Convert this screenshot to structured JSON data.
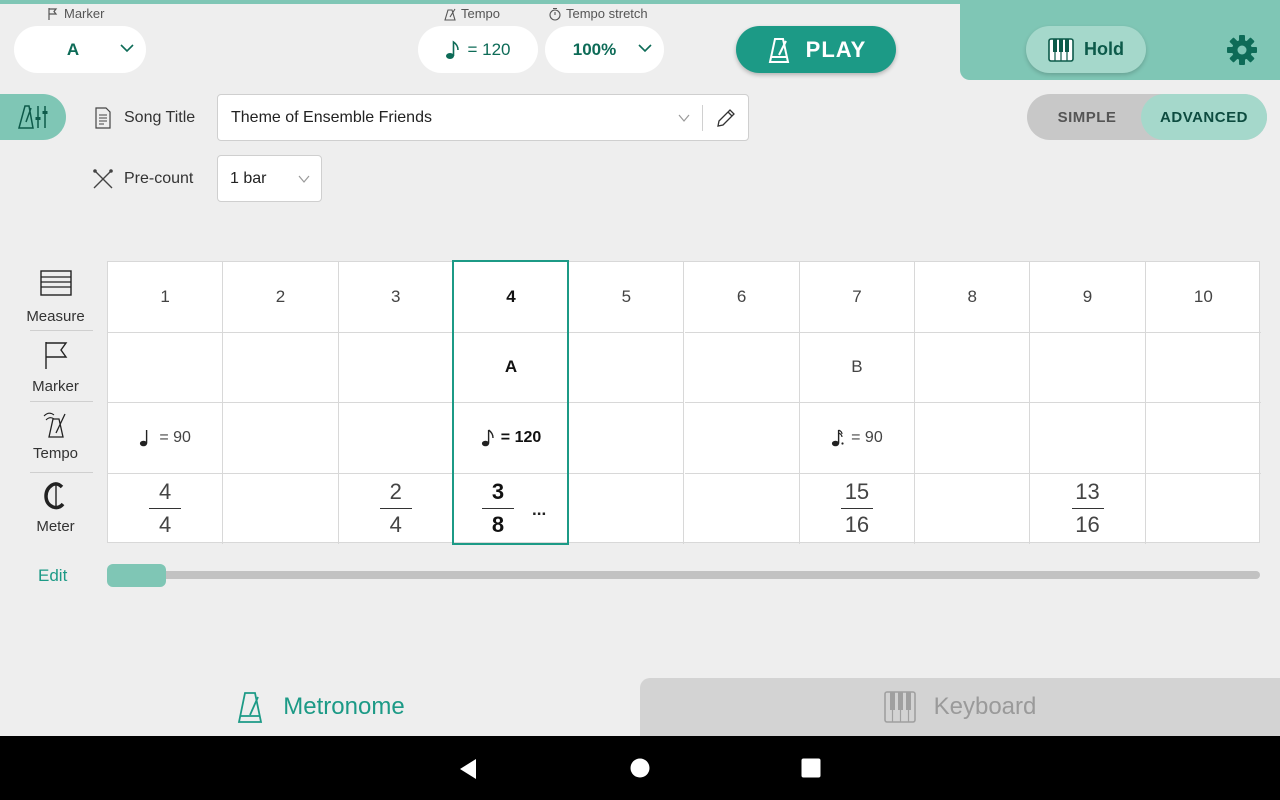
{
  "topbar": {
    "marker_label": "Marker",
    "marker_value": "A",
    "tempo_label": "Tempo",
    "tempo_value": "= 120",
    "tempo_stretch_label": "Tempo stretch",
    "tempo_stretch_value": "100%",
    "play_label": "PLAY",
    "hold_label": "Hold"
  },
  "song": {
    "title_label": "Song Title",
    "title_value": "Theme of Ensemble Friends",
    "precount_label": "Pre-count",
    "precount_value": "1 bar"
  },
  "mode_toggle": {
    "simple": "SIMPLE",
    "advanced": "ADVANCED",
    "selected": "ADVANCED"
  },
  "sidebar_rows": {
    "measure": "Measure",
    "marker": "Marker",
    "tempo": "Tempo",
    "meter": "Meter"
  },
  "grid": {
    "measures": [
      "1",
      "2",
      "3",
      "4",
      "5",
      "6",
      "7",
      "8",
      "9",
      "10"
    ],
    "selected_measure": "4",
    "markers": [
      "",
      "",
      "",
      "A",
      "",
      "",
      "B",
      "",
      "",
      ""
    ],
    "tempos": [
      "= 90",
      "",
      "",
      "= 120",
      "",
      "",
      "= 90",
      "",
      "",
      ""
    ],
    "tempo_notes": [
      "quarter",
      "",
      "",
      "eighth",
      "",
      "",
      "dotted-sixteenth",
      "",
      "",
      ""
    ],
    "meters": [
      {
        "num": "4",
        "den": "4"
      },
      null,
      {
        "num": "2",
        "den": "4"
      },
      {
        "num": "3",
        "den": "8",
        "more": "..."
      },
      null,
      null,
      {
        "num": "15",
        "den": "16"
      },
      null,
      {
        "num": "13",
        "den": "16"
      },
      null
    ]
  },
  "edit_label": "Edit",
  "scroll_position": 0,
  "tabs": {
    "metronome": "Metronome",
    "keyboard": "Keyboard",
    "selected": "Metronome"
  },
  "colors": {
    "accent": "#1c9a86",
    "accent_light": "#7fc6b5",
    "accent_pale": "#a5d8cb"
  }
}
